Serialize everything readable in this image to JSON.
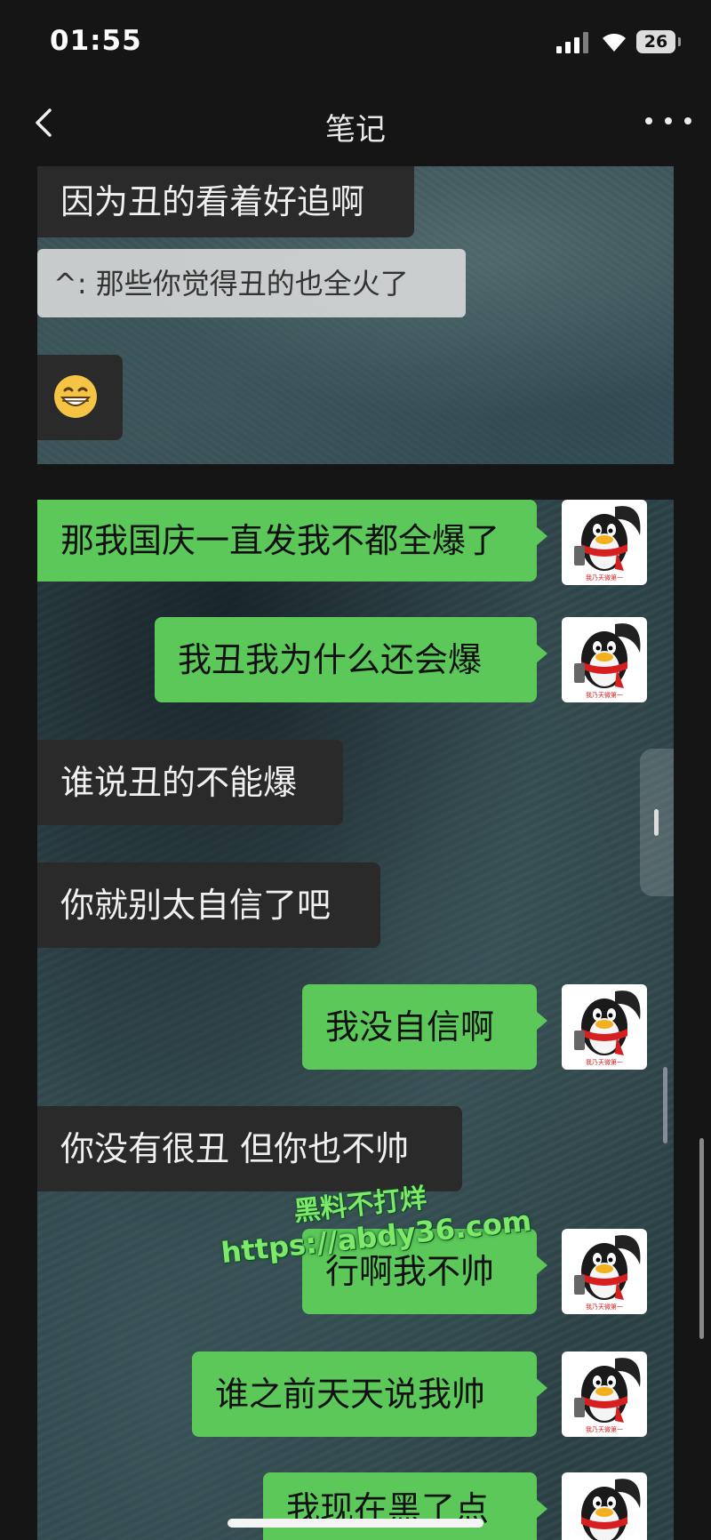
{
  "status_bar": {
    "time": "01:55",
    "battery": "26"
  },
  "nav": {
    "title": "笔记"
  },
  "top_panel": {
    "message1": "因为丑的看着好追啊",
    "quote": "^:  那些你觉得丑的也全火了",
    "emoji": "grinning-face"
  },
  "chat": {
    "messages": [
      {
        "side": "sent",
        "text": "那我国庆一直发我不都全爆了"
      },
      {
        "side": "sent",
        "text": "我丑我为什么还会爆"
      },
      {
        "side": "received",
        "text": "谁说丑的不能爆"
      },
      {
        "side": "received",
        "text": "你就别太自信了吧"
      },
      {
        "side": "sent",
        "text": "我没自信啊"
      },
      {
        "side": "received",
        "text": "你没有很丑 但你也不帅"
      },
      {
        "side": "sent",
        "text": "行啊我不帅"
      },
      {
        "side": "sent",
        "text": "谁之前天天说我帅"
      },
      {
        "side": "sent",
        "text": "我现在黑了点"
      }
    ]
  },
  "watermark": {
    "line1": "黑料不打烊",
    "line2": "https://abdy36.com"
  },
  "colors": {
    "sent_bubble": "#5cc85a",
    "recv_bubble": "#2a2a2a",
    "background": "#151515"
  }
}
